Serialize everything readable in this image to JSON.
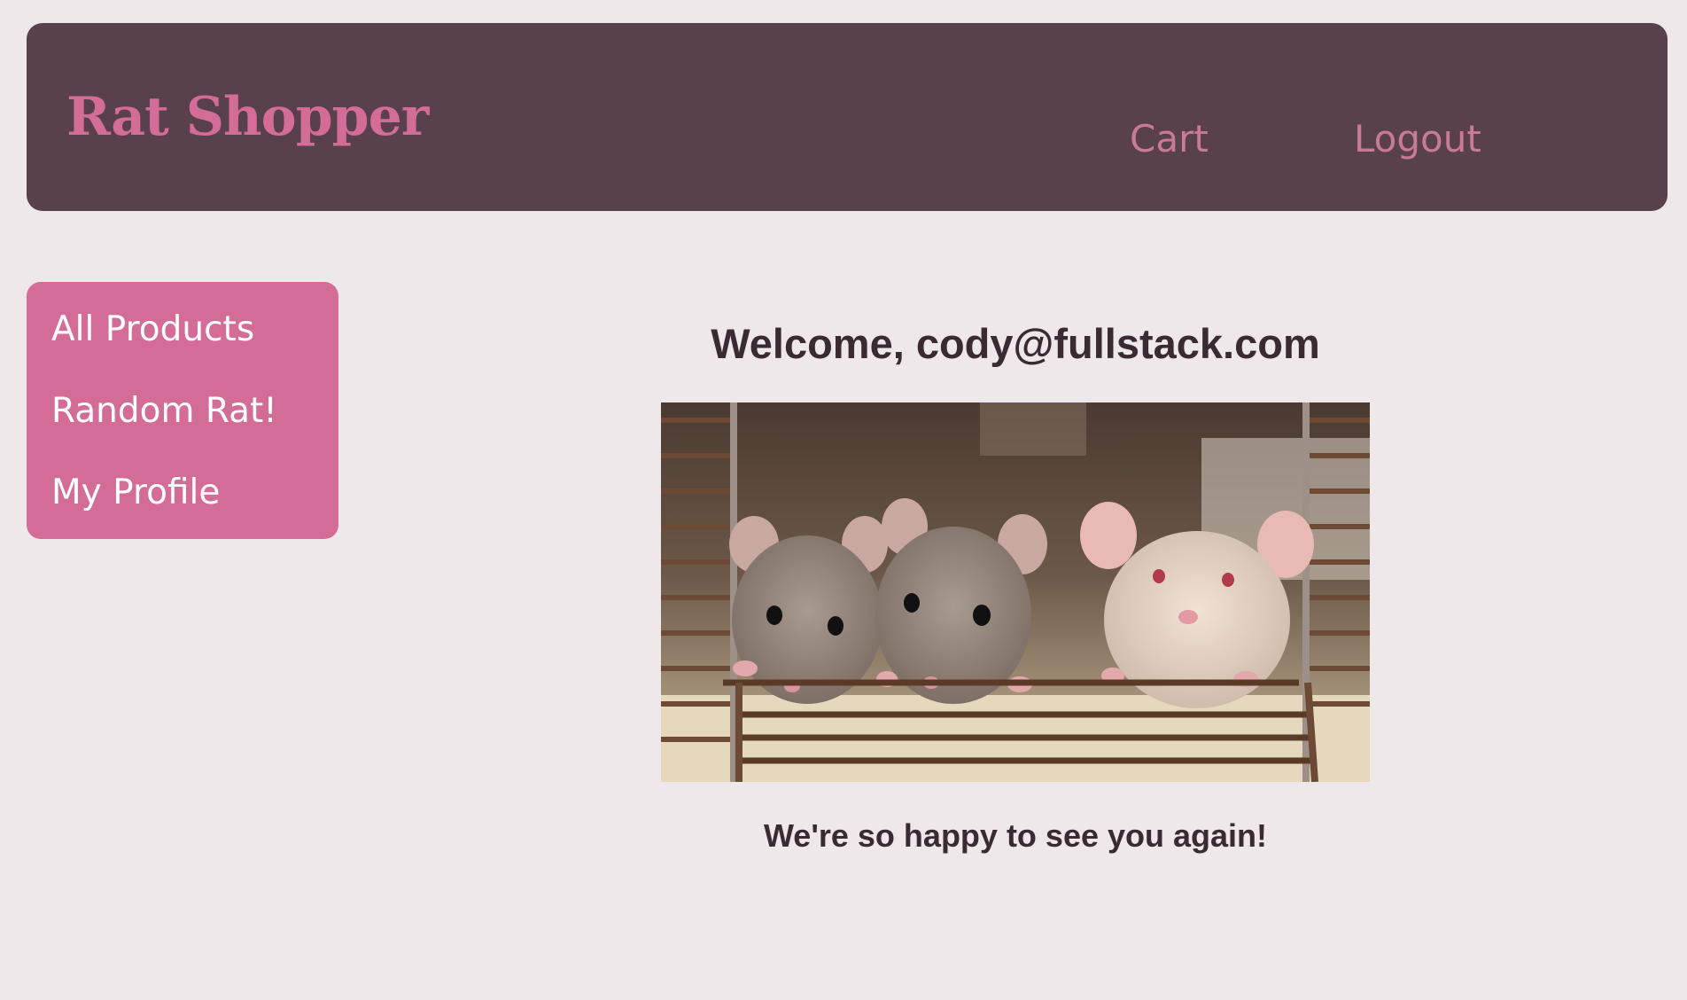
{
  "header": {
    "brand": "Rat Shopper",
    "nav": {
      "cart": "Cart",
      "logout": "Logout"
    }
  },
  "sidebar": {
    "items": [
      {
        "label": "All Products"
      },
      {
        "label": "Random Rat!"
      },
      {
        "label": "My Profile"
      }
    ]
  },
  "main": {
    "welcome": "Welcome, cody@fullstack.com",
    "subtitle": "We're so happy to see you again!",
    "hero_image_alt": "three rats in a cage"
  },
  "colors": {
    "background": "#efe8ea",
    "header_bg": "#58404c",
    "brand": "#d46c98",
    "nav_link": "#c9799a",
    "sidebar_bg": "#d46c98",
    "sidebar_text": "#ffffff",
    "body_text": "#3a2a32"
  }
}
